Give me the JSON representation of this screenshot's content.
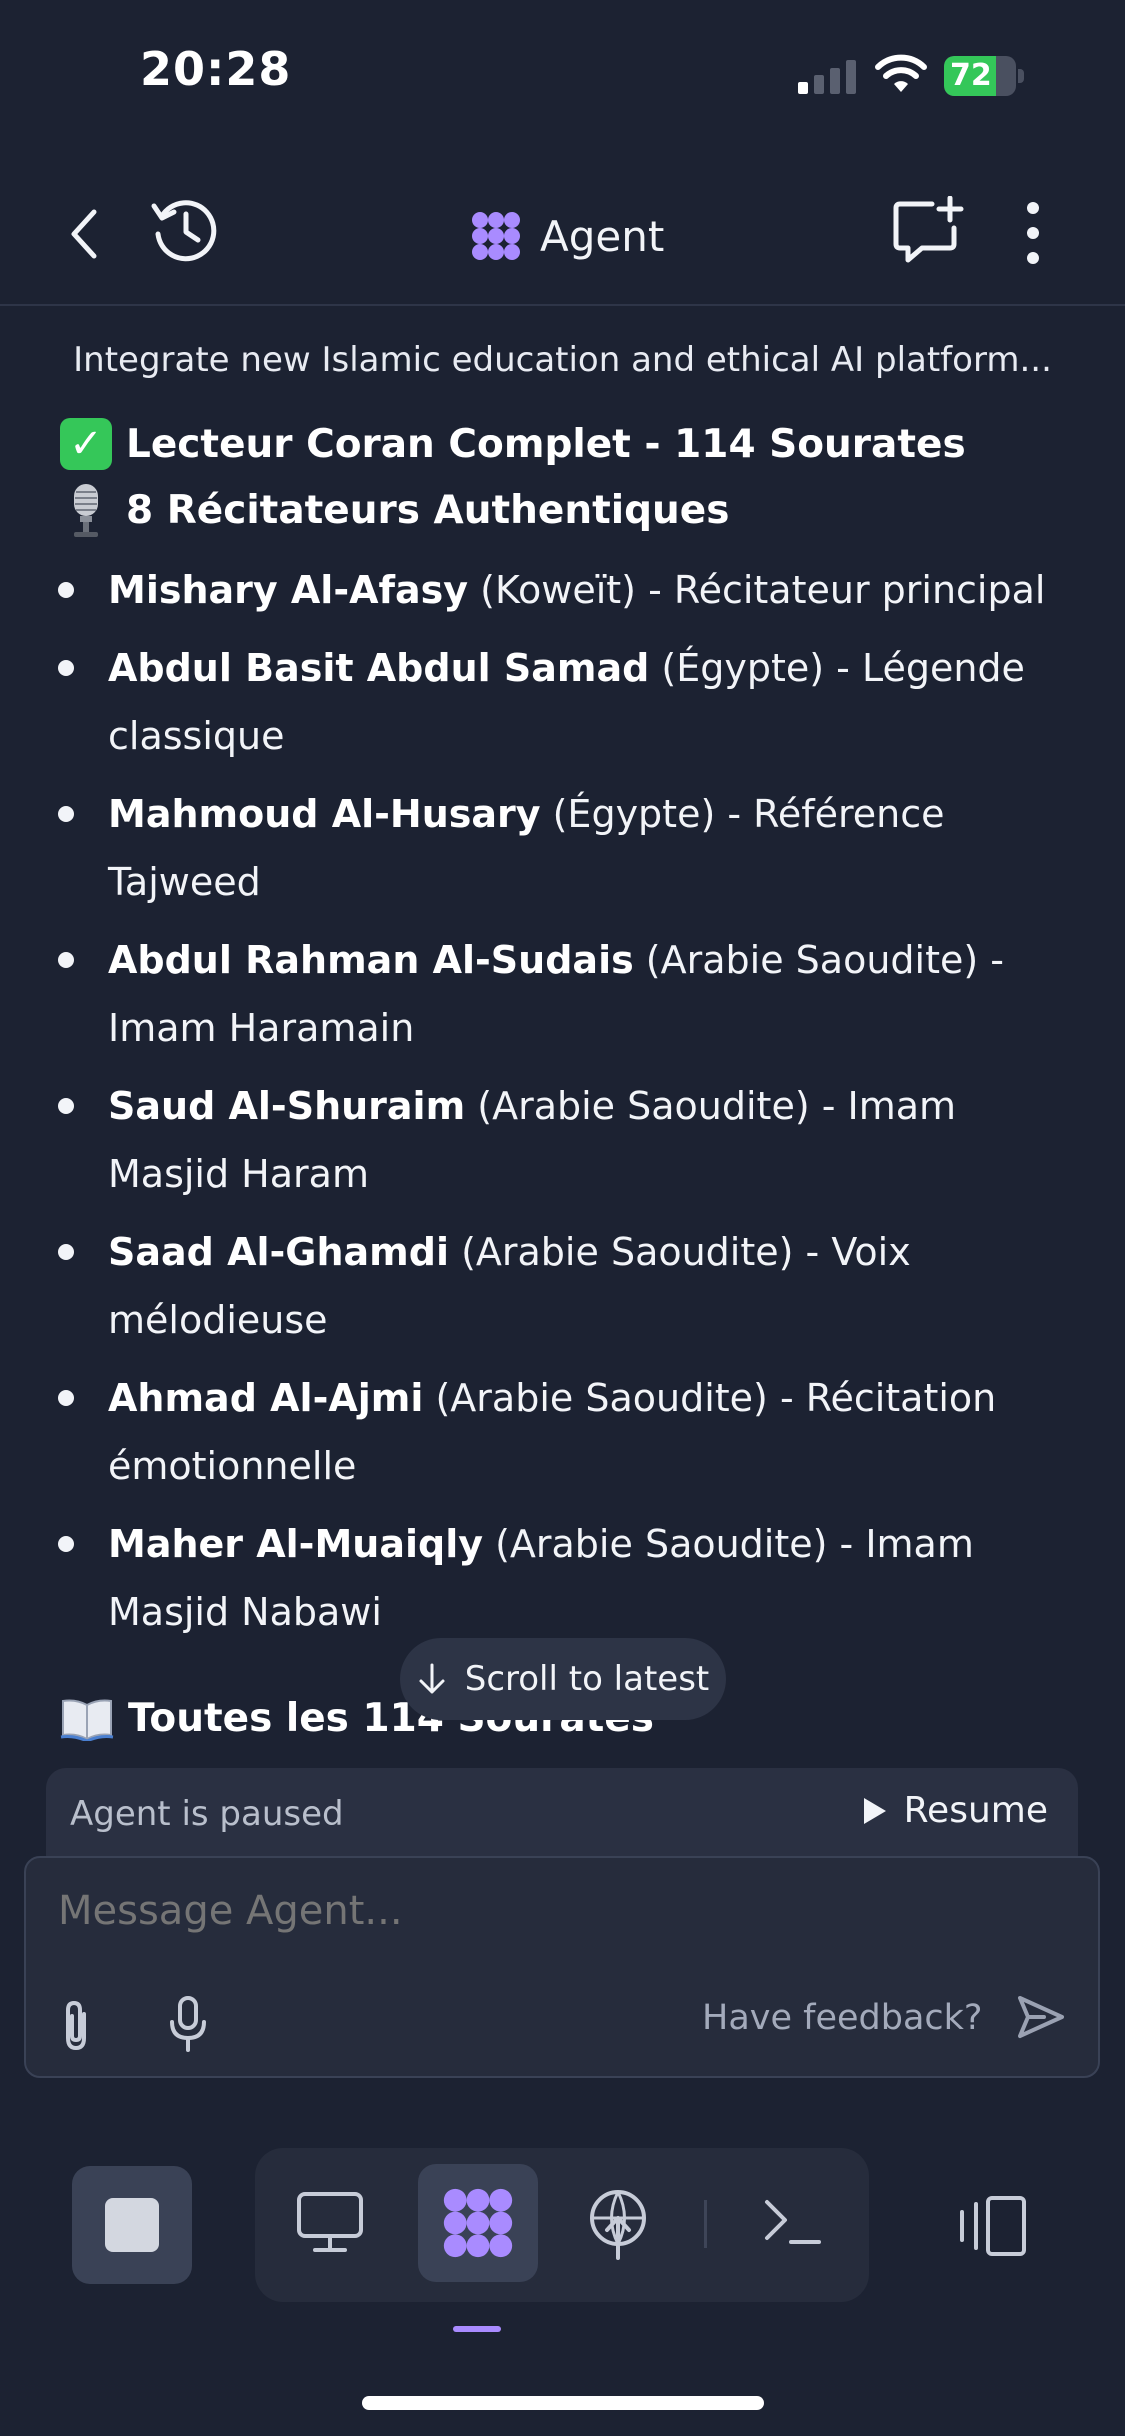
{
  "status_bar": {
    "time": "20:28",
    "battery": "72",
    "battery_level": 0.72
  },
  "header": {
    "title": "Agent"
  },
  "thread": {
    "title": "Integrate new Islamic education and ethical AI platform..."
  },
  "content": {
    "heading1": "Lecteur Coran Complet - 114 Sourates",
    "heading1_emoji": "✓",
    "heading2": "8 Récitateurs Authentiques",
    "reciters": [
      {
        "name": "Mishary Al-Afasy",
        "detail": " (Koweït) - Récitateur principal"
      },
      {
        "name": "Abdul Basit Abdul Samad",
        "detail": " (Égypte) - Légende classique"
      },
      {
        "name": "Mahmoud Al-Husary",
        "detail": " (Égypte) - Référence Tajweed"
      },
      {
        "name": "Abdul Rahman Al-Sudais",
        "detail": " (Arabie Saoudite) - Imam Haramain"
      },
      {
        "name": "Saud Al-Shuraim",
        "detail": " (Arabie Saoudite) - Imam Masjid Haram"
      },
      {
        "name": "Saad Al-Ghamdi",
        "detail": " (Arabie Saoudite) - Voix mélodieuse"
      },
      {
        "name": "Ahmad Al-Ajmi",
        "detail": " (Arabie Saoudite) - Récitation émotionnelle"
      },
      {
        "name": "Maher Al-Muaiqly",
        "detail": " (Arabie Saoudite) - Imam Masjid Nabawi"
      }
    ],
    "heading3": "Toutes les 114 Sourates"
  },
  "scroll_latest": {
    "label": "Scroll to latest"
  },
  "paused": {
    "text": "Agent is paused",
    "resume_label": "Resume"
  },
  "composer": {
    "placeholder": "Message Agent...",
    "feedback_label": "Have feedback?"
  },
  "colors": {
    "accent": "#a98bff",
    "background": "#1c2232",
    "success": "#34c759"
  }
}
